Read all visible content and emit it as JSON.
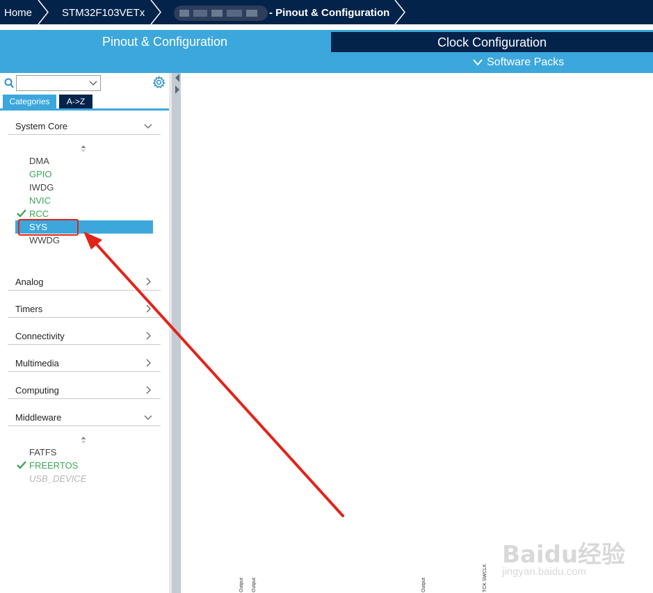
{
  "breadcrumb": {
    "home": "Home",
    "device": "STM32F103VETx",
    "page": "- Pinout & Configuration"
  },
  "tabs": {
    "pinout": "Pinout & Configuration",
    "clock": "Clock Configuration",
    "software_packs": "Software Packs"
  },
  "sidebar": {
    "search_value": "",
    "view_tabs": {
      "categories": "Categories",
      "az": "A->Z"
    },
    "categories": [
      {
        "label": "System Core",
        "expanded": true
      },
      {
        "label": "Analog",
        "expanded": false
      },
      {
        "label": "Timers",
        "expanded": false
      },
      {
        "label": "Connectivity",
        "expanded": false
      },
      {
        "label": "Multimedia",
        "expanded": false
      },
      {
        "label": "Computing",
        "expanded": false
      },
      {
        "label": "Middleware",
        "expanded": true
      }
    ],
    "system_core_items": [
      {
        "label": "DMA",
        "state": "normal"
      },
      {
        "label": "GPIO",
        "state": "configured"
      },
      {
        "label": "IWDG",
        "state": "normal"
      },
      {
        "label": "NVIC",
        "state": "configured"
      },
      {
        "label": "RCC",
        "state": "checked"
      },
      {
        "label": "SYS",
        "state": "selected"
      },
      {
        "label": "WWDG",
        "state": "normal"
      }
    ],
    "middleware_items": [
      {
        "label": "FATFS",
        "state": "normal"
      },
      {
        "label": "FREERTOS",
        "state": "checked"
      },
      {
        "label": "USB_DEVICE",
        "state": "disabled"
      }
    ]
  },
  "pin_labels": [
    "Output",
    "Output",
    "Output",
    "TCK SWCLK"
  ],
  "watermark": {
    "main": "Baidu经验",
    "sub": "jingyan.baidu.com"
  },
  "colors": {
    "navy": "#03234b",
    "accent_blue": "#3ca7dc",
    "configured_green": "#3aa655",
    "annotation_red": "#e2231a"
  }
}
